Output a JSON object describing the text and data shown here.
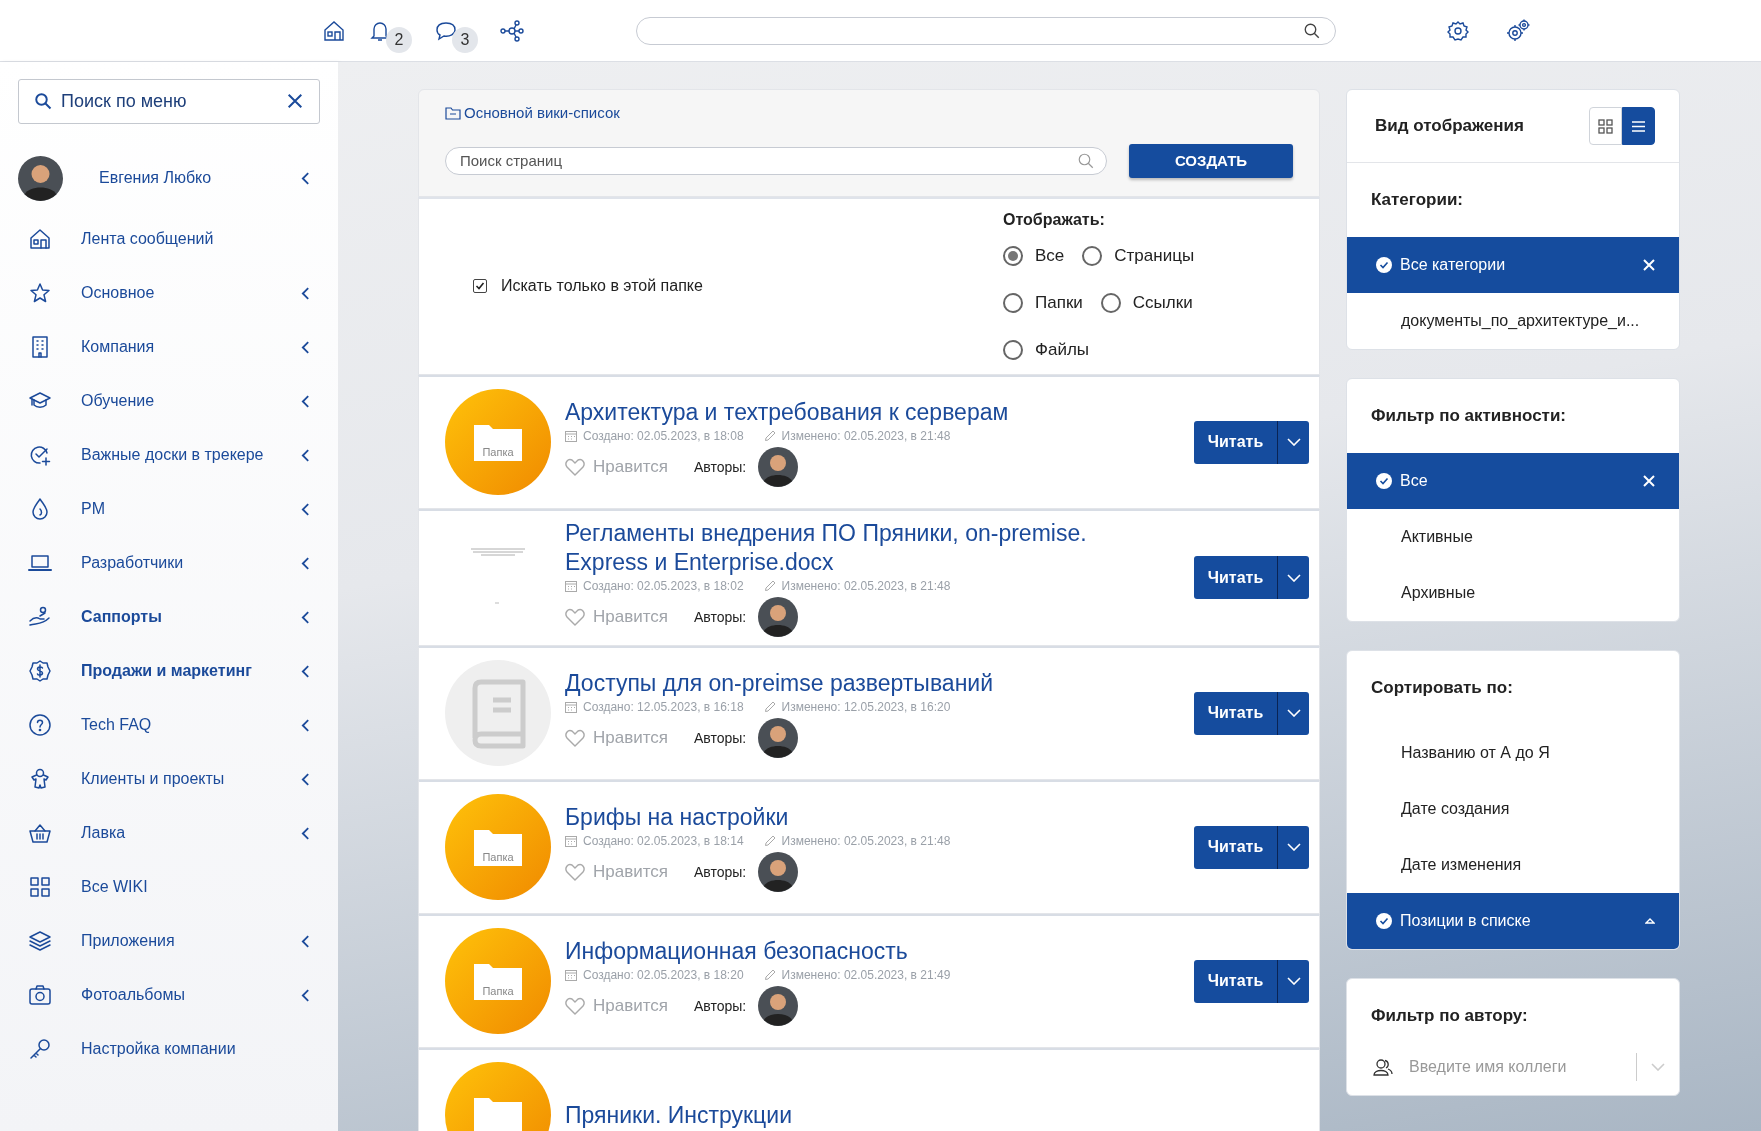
{
  "topbar": {
    "notifications_badge": "2",
    "messages_badge": "3"
  },
  "sidebar": {
    "search": {
      "placeholder": "Поиск по меню"
    },
    "user": {
      "name": "Евгения Любко",
      "expandable": true
    },
    "items": [
      {
        "kind": "home",
        "label": "Лента сообщений",
        "bold": false,
        "expandable": false
      },
      {
        "kind": "star",
        "label": "Основное",
        "bold": false,
        "expandable": true
      },
      {
        "kind": "building",
        "label": "Компания",
        "bold": false,
        "expandable": true
      },
      {
        "kind": "cap",
        "label": "Обучение",
        "bold": false,
        "expandable": true
      },
      {
        "kind": "check-plus",
        "label": "Важные доски в трекере",
        "bold": false,
        "expandable": true
      },
      {
        "kind": "drop",
        "label": "PM",
        "bold": false,
        "expandable": true
      },
      {
        "kind": "laptop",
        "label": "Разработчики",
        "bold": false,
        "expandable": true
      },
      {
        "kind": "hand",
        "label": "Саппорты",
        "bold": true,
        "expandable": true
      },
      {
        "kind": "dollar",
        "label": "Продажи и маркетинг",
        "bold": true,
        "expandable": true
      },
      {
        "kind": "question",
        "label": "Tech FAQ",
        "bold": false,
        "expandable": true
      },
      {
        "kind": "gingerbread",
        "label": "Клиенты и проекты",
        "bold": false,
        "expandable": true
      },
      {
        "kind": "basket",
        "label": "Лавка",
        "bold": false,
        "expandable": true
      },
      {
        "kind": "grid",
        "label": "Все WIKI",
        "bold": false,
        "expandable": false
      },
      {
        "kind": "layers",
        "label": "Приложения",
        "bold": false,
        "expandable": true
      },
      {
        "kind": "camera",
        "label": "Фотоальбомы",
        "bold": false,
        "expandable": true
      },
      {
        "kind": "key",
        "label": "Настройка компании",
        "bold": false,
        "expandable": false
      }
    ]
  },
  "header": {
    "breadcrumb": "Основной вики-список",
    "search": {
      "placeholder": "Поиск страниц"
    },
    "create_button": "СОЗДАТЬ"
  },
  "filters": {
    "search_in_folder": {
      "label": "Искать только в этой папке",
      "checked": true
    },
    "display": {
      "title": "Отображать:",
      "rows": [
        [
          {
            "label": "Все",
            "selected": true
          },
          {
            "label": "Страницы",
            "selected": false
          }
        ],
        [
          {
            "label": "Папки",
            "selected": false
          },
          {
            "label": "Ссылки",
            "selected": false
          }
        ],
        [
          {
            "label": "Файлы",
            "selected": false
          }
        ]
      ]
    }
  },
  "pages": [
    {
      "kind": "folder",
      "thumb_label": "Папка",
      "title": "Архитектура и техтребования к серверам",
      "created": "Создано: 02.05.2023, в 18:08",
      "modified": "Изменено: 02.05.2023, в 21:48",
      "like": "Нравится",
      "authors_label": "Авторы:",
      "read_button": "Читать"
    },
    {
      "kind": "document",
      "title": "Регламенты внедрения ПО Пряники, on-premise. Express и Enterprise.docx",
      "created": "Создано: 02.05.2023, в 18:02",
      "modified": "Изменено: 02.05.2023, в 21:48",
      "like": "Нравится",
      "authors_label": "Авторы:",
      "read_button": "Читать"
    },
    {
      "kind": "book",
      "title": "Доступы для on-preimse развертываний",
      "created": "Создано: 12.05.2023, в 16:18",
      "modified": "Изменено: 12.05.2023, в 16:20",
      "like": "Нравится",
      "authors_label": "Авторы:",
      "read_button": "Читать"
    },
    {
      "kind": "folder",
      "thumb_label": "Папка",
      "title": "Брифы на настройки",
      "created": "Создано: 02.05.2023, в 18:14",
      "modified": "Изменено: 02.05.2023, в 21:48",
      "like": "Нравится",
      "authors_label": "Авторы:",
      "read_button": "Читать"
    },
    {
      "kind": "folder",
      "thumb_label": "Папка",
      "title": "Информационная безопасность",
      "created": "Создано: 02.05.2023, в 18:20",
      "modified": "Изменено: 02.05.2023, в 21:49",
      "like": "Нравится",
      "authors_label": "Авторы:",
      "read_button": "Читать"
    },
    {
      "kind": "folder",
      "title": "Пряники. Инструкции"
    }
  ],
  "view_mode": {
    "title": "Вид отображения",
    "options": [
      {
        "kind": "grid",
        "selected": false
      },
      {
        "kind": "list",
        "selected": true
      }
    ]
  },
  "panels": [
    {
      "kind": "filter",
      "title": "Категории:",
      "items": [
        {
          "label": "Все категории",
          "selected": true
        },
        {
          "label": "документы_по_архитектуре_и...",
          "selected": false
        }
      ]
    },
    {
      "kind": "filter",
      "title": "Фильтр по активности:",
      "items": [
        {
          "label": "Все",
          "selected": true
        },
        {
          "label": "Активные",
          "selected": false
        },
        {
          "label": "Архивные",
          "selected": false
        }
      ]
    },
    {
      "kind": "sort",
      "title": "Сортировать по:",
      "items": [
        {
          "label": "Названию от А до Я",
          "selected": false
        },
        {
          "label": "Дате создания",
          "selected": false
        },
        {
          "label": "Дате изменения",
          "selected": false
        },
        {
          "label": "Позиции в списке",
          "selected": true
        }
      ]
    }
  ],
  "author_filter": {
    "title": "Фильтр по автору:",
    "placeholder": "Введите имя коллеги"
  }
}
